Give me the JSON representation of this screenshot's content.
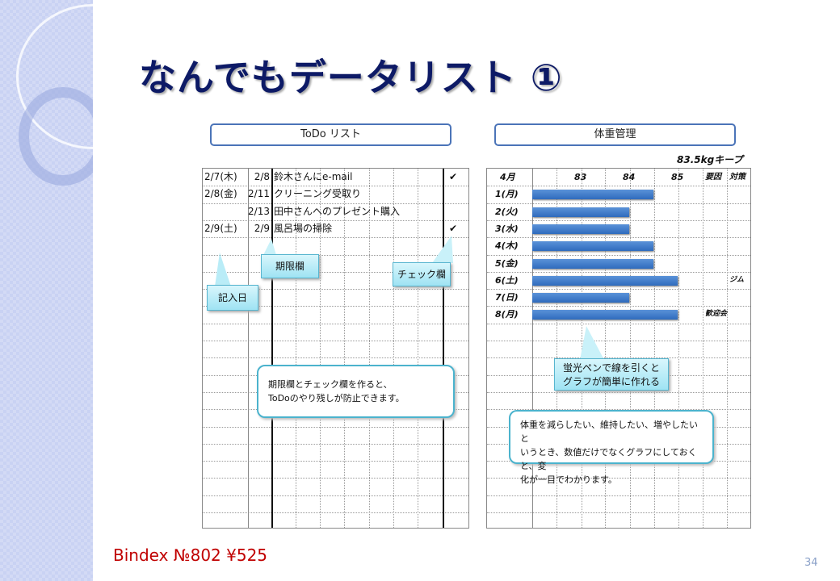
{
  "title": "なんでもデータリスト ①",
  "todo": {
    "header": "ToDo リスト",
    "rows": [
      {
        "entry": "2/7(木)",
        "due": "2/8",
        "task": "鈴木さんにe-mail",
        "check": "✔"
      },
      {
        "entry": "2/8(金)",
        "due": "2/11",
        "task": "クリーニング受取り",
        "check": ""
      },
      {
        "entry": "",
        "due": "2/13",
        "task": "田中さんへのプレゼント購入",
        "check": ""
      },
      {
        "entry": "2/9(土)",
        "due": "2/9",
        "task": "風呂場の掃除",
        "check": "✔"
      }
    ],
    "callouts": {
      "entry_date": "記入日",
      "due": "期限欄",
      "check": "チェック欄"
    },
    "note": [
      "期限欄とチェック欄を作ると、",
      "ToDoのやり残しが防止できます。"
    ]
  },
  "weight": {
    "header": "体重管理",
    "goal": "83.5kgキープ",
    "month": "4月",
    "col_cause": "要因",
    "col_action": "対策",
    "callout": [
      "蛍光ペンで線を引くと",
      "グラフが簡単に作れる"
    ],
    "note": [
      "体重を減らしたい、維持したい、増やしたいと",
      "いうとき、数値だけでなくグラフにしておくと、変",
      "化が一目でわかります。"
    ],
    "chart_data": {
      "type": "bar",
      "orientation": "horizontal",
      "categories": [
        "1(月)",
        "2(火)",
        "3(水)",
        "4(木)",
        "5(金)",
        "6(土)",
        "7(日)",
        "8(月)"
      ],
      "values": [
        84.5,
        84,
        84,
        84.5,
        84.5,
        85,
        84,
        85
      ],
      "tick_labels": [
        "83",
        "84",
        "85"
      ],
      "xlim": [
        82,
        85
      ],
      "grid": true,
      "bar_color": "#2f6bbd"
    },
    "causes": [
      "",
      "",
      "",
      "",
      "",
      "",
      "",
      "歓迎会"
    ],
    "actions": [
      "",
      "",
      "",
      "",
      "",
      "ジム",
      "",
      ""
    ]
  },
  "footer": {
    "product": "Bindex №802 ¥525",
    "page": "34"
  }
}
